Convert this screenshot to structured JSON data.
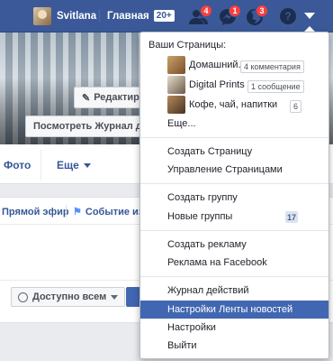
{
  "topbar": {
    "user_name": "Svitlana",
    "home_label": "Главная",
    "home_count": "20+",
    "friends_badge": "4",
    "messages_badge": "1",
    "notifications_badge": "3",
    "help_label": "?"
  },
  "profile": {
    "edit_button": "Редактиро",
    "activity_log_button": "Посмотреть Журнал де",
    "tabs": {
      "photo": "Фото",
      "more": "Еще"
    }
  },
  "composer": {
    "live_label": "Прямой эфир",
    "event_label": "Событие из",
    "audience_label": "Доступно всем"
  },
  "dropdown": {
    "header": "Ваши Страницы:",
    "pages": [
      {
        "name": "Домашний...",
        "badge": "4 комментария"
      },
      {
        "name": "Digital Prints ...",
        "badge": "1 сообщение"
      },
      {
        "name": "Кофе, чай, напитки",
        "badge": "6"
      }
    ],
    "more": "Еще...",
    "create_page": "Создать Страницу",
    "manage_pages": "Управление Страницами",
    "create_group": "Создать группу",
    "new_groups": "Новые группы",
    "new_groups_badge": "17",
    "create_ad": "Создать рекламу",
    "ads_on_facebook": "Реклама на Facebook",
    "activity_log": "Журнал действий",
    "news_feed_settings": "Настройки Ленты новостей",
    "settings": "Настройки",
    "logout": "Выйти"
  },
  "colors": {
    "brand_blue": "#3b5998",
    "highlight_blue": "#4267b2",
    "notification_red": "#fa3e3e"
  }
}
